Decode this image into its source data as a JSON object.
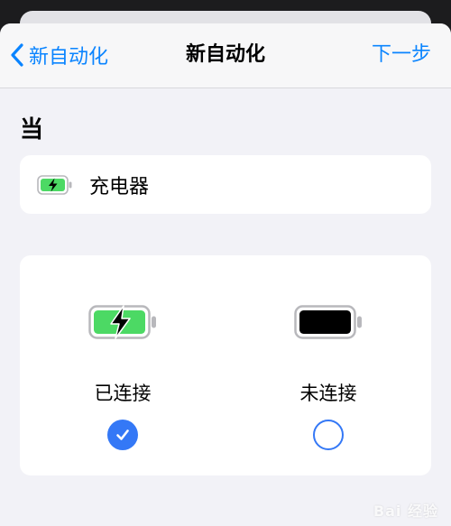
{
  "navbar": {
    "back_label": "新自动化",
    "title": "新自动化",
    "next_label": "下一步"
  },
  "section": {
    "header": "当"
  },
  "trigger": {
    "label": "充电器",
    "icon": "battery-charging-icon"
  },
  "options": [
    {
      "label": "已连接",
      "icon": "battery-charging-icon",
      "selected": true
    },
    {
      "label": "未连接",
      "icon": "battery-icon",
      "selected": false
    }
  ],
  "watermark": {
    "text": "Bai 经验"
  },
  "colors": {
    "accent": "#0a84ff",
    "radio": "#3478f6",
    "battery_green": "#4cd964",
    "background": "#f2f2f7",
    "card": "#ffffff"
  }
}
